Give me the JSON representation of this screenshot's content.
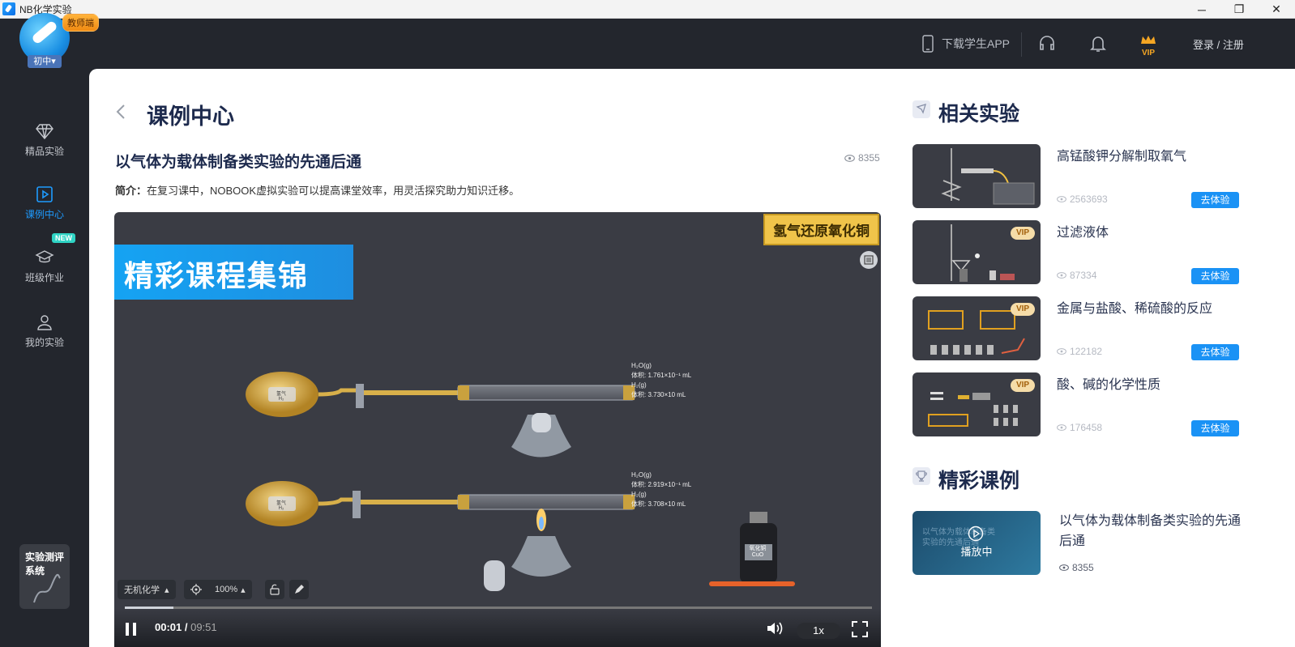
{
  "window": {
    "title": "NB化学实验",
    "minimize": "─",
    "maximize": "❐",
    "close": "✕"
  },
  "sidebar": {
    "role_badge": "教师端",
    "level": "初中▾",
    "items": [
      {
        "label": "精品实验",
        "icon": "diamond-icon"
      },
      {
        "label": "课例中心",
        "icon": "play-square-icon",
        "active": true
      },
      {
        "label": "班级作业",
        "icon": "graduation-cap-icon",
        "tag": "NEW"
      },
      {
        "label": "我的实验",
        "icon": "user-icon"
      }
    ],
    "eval_system": "实验测评系统"
  },
  "topbar": {
    "download": "下载学生APP",
    "vip": "VIP",
    "login": "登录 / 注册"
  },
  "main": {
    "page_title": "课例中心",
    "lesson_title": "以气体为载体制备类实验的先通后通",
    "views": "8355",
    "intro_label": "简介：",
    "intro_text": "在复习课中，NOBOOK虚拟实验可以提高课堂效率，用灵活探究助力知识迁移。"
  },
  "video": {
    "banner": "精彩课程集锦",
    "corner_tag": "氢气还原氧化铜",
    "subject": "无机化学",
    "zoom": "100%",
    "time_current": "00:01",
    "time_sep": " / ",
    "time_total": "09:51",
    "speed": "1x",
    "progress": 0.065,
    "labels": {
      "gas_top_1": "H₂O(g)",
      "gas_top_2": "体积: 1.761×10⁻¹ mL",
      "gas_top_3": "H₂(g)",
      "gas_top_4": "体积: 3.730×10 mL",
      "gas_bot_1": "H₂O(g)",
      "gas_bot_2": "体积: 2.919×10⁻¹ mL",
      "gas_bot_3": "H₂(g)",
      "gas_bot_4": "体积: 3.708×10 mL",
      "bag_top": "氢气 H₂",
      "bag_bot": "氢气 H₂",
      "bottle": "氧化铜 CuO"
    }
  },
  "related": {
    "title": "相关实验",
    "go_label": "去体验",
    "vip_label": "VIP",
    "items": [
      {
        "name": "高锰酸钾分解制取氧气",
        "views": "2563693",
        "vip": false
      },
      {
        "name": "过滤液体",
        "views": "87334",
        "vip": true
      },
      {
        "name": "金属与盐酸、稀硫酸的反应",
        "views": "122182",
        "vip": true
      },
      {
        "name": "酸、碱的化学性质",
        "views": "176458",
        "vip": true
      }
    ]
  },
  "featured": {
    "title": "精彩课例",
    "playing": "播放中",
    "name": "以气体为载体制备类实验的先通后通",
    "views": "8355",
    "thumb_text": "以气体为载体制备类实验的先通后通"
  }
}
